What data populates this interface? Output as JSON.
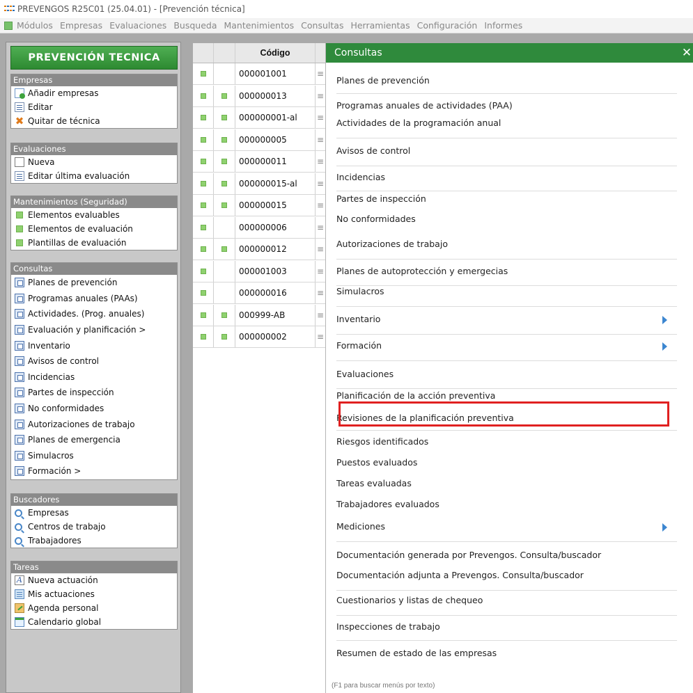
{
  "window": {
    "title": "PREVENGOS R25C01 (25.04.01) - [Prevención técnica]"
  },
  "menubar": {
    "items": [
      "Módulos",
      "Empresas",
      "Evaluaciones",
      "Busqueda",
      "Mantenimientos",
      "Consultas",
      "Herramientas",
      "Configuración",
      "Informes"
    ]
  },
  "sidebar": {
    "header": "PREVENCIÓN TECNICA",
    "sections": {
      "empresas": {
        "title": "Empresas",
        "items": [
          "Añadir empresas",
          "Editar",
          "Quitar de técnica"
        ]
      },
      "evaluaciones": {
        "title": "Evaluaciones",
        "items": [
          "Nueva",
          "Editar última evaluación"
        ]
      },
      "mantenimientos": {
        "title": "Mantenimientos (Seguridad)",
        "items": [
          "Elementos evaluables",
          "Elementos de evaluación",
          "Plantillas de evaluación"
        ]
      },
      "consultas": {
        "title": "Consultas",
        "items": [
          "Planes de prevención",
          "Programas anuales (PAAs)",
          "Actividades. (Prog. anuales)",
          "Evaluación y planificación  >",
          "Inventario",
          "Avisos de control",
          "Incidencias",
          "Partes de inspección",
          "No conformidades",
          "Autorizaciones de trabajo",
          "Planes de emergencia",
          "Simulacros",
          "Formación  >"
        ]
      },
      "buscadores": {
        "title": "Buscadores",
        "items": [
          "Empresas",
          "Centros de trabajo",
          "Trabajadores"
        ]
      },
      "tareas": {
        "title": "Tareas",
        "items": [
          "Nueva actuación",
          "Mis actuaciones",
          "Agenda personal",
          "Calendario global"
        ]
      }
    }
  },
  "table": {
    "header": "Código",
    "rows": [
      {
        "codigo": "000001001",
        "c2": false
      },
      {
        "codigo": "000000013",
        "c2": true
      },
      {
        "codigo": "000000001-al",
        "c2": true
      },
      {
        "codigo": "000000005",
        "c2": true
      },
      {
        "codigo": "000000011",
        "c2": true
      },
      {
        "codigo": "000000015-al",
        "c2": true
      },
      {
        "codigo": "000000015",
        "c2": true
      },
      {
        "codigo": "000000006",
        "c2": false
      },
      {
        "codigo": "000000012",
        "c2": true
      },
      {
        "codigo": "000001003",
        "c2": false
      },
      {
        "codigo": "000000016",
        "c2": false
      },
      {
        "codigo": "000999-AB",
        "c2": true
      },
      {
        "codigo": "000000002",
        "c2": true
      }
    ]
  },
  "consultas_menu": {
    "title": "Consultas",
    "close": "✕",
    "items": [
      "Planes de prevención",
      "Programas anuales de actividades (PAA)",
      "Actividades de la programación anual",
      "Avisos de control",
      "Incidencias",
      "Partes de inspección",
      "No conformidades",
      "Autorizaciones de trabajo",
      "Planes de autoprotección y emergecias",
      "Simulacros",
      "Inventario",
      "Formación",
      "Evaluaciones",
      "Planificación de la acción preventiva",
      "Revisiones de la planificación preventiva",
      "Riesgos identificados",
      "Puestos evaluados",
      "Tareas evaluadas",
      "Trabajadores evaluados",
      "Mediciones",
      "Documentación generada por Prevengos. Consulta/buscador",
      "Documentación adjunta a Prevengos. Consulta/buscador",
      "Cuestionarios y listas de chequeo",
      "Inspecciones de trabajo",
      "Resumen de estado de las empresas"
    ],
    "submenu_items": [
      "Inventario",
      "Formación",
      "Mediciones"
    ],
    "highlighted_item": "Revisiones de la planificación preventiva",
    "hint": "(F1 para buscar menús por texto)"
  },
  "colors": {
    "accent_green": "#2f8a3c",
    "highlight_red": "#e02020",
    "submenu_arrow": "#3c86d0"
  }
}
